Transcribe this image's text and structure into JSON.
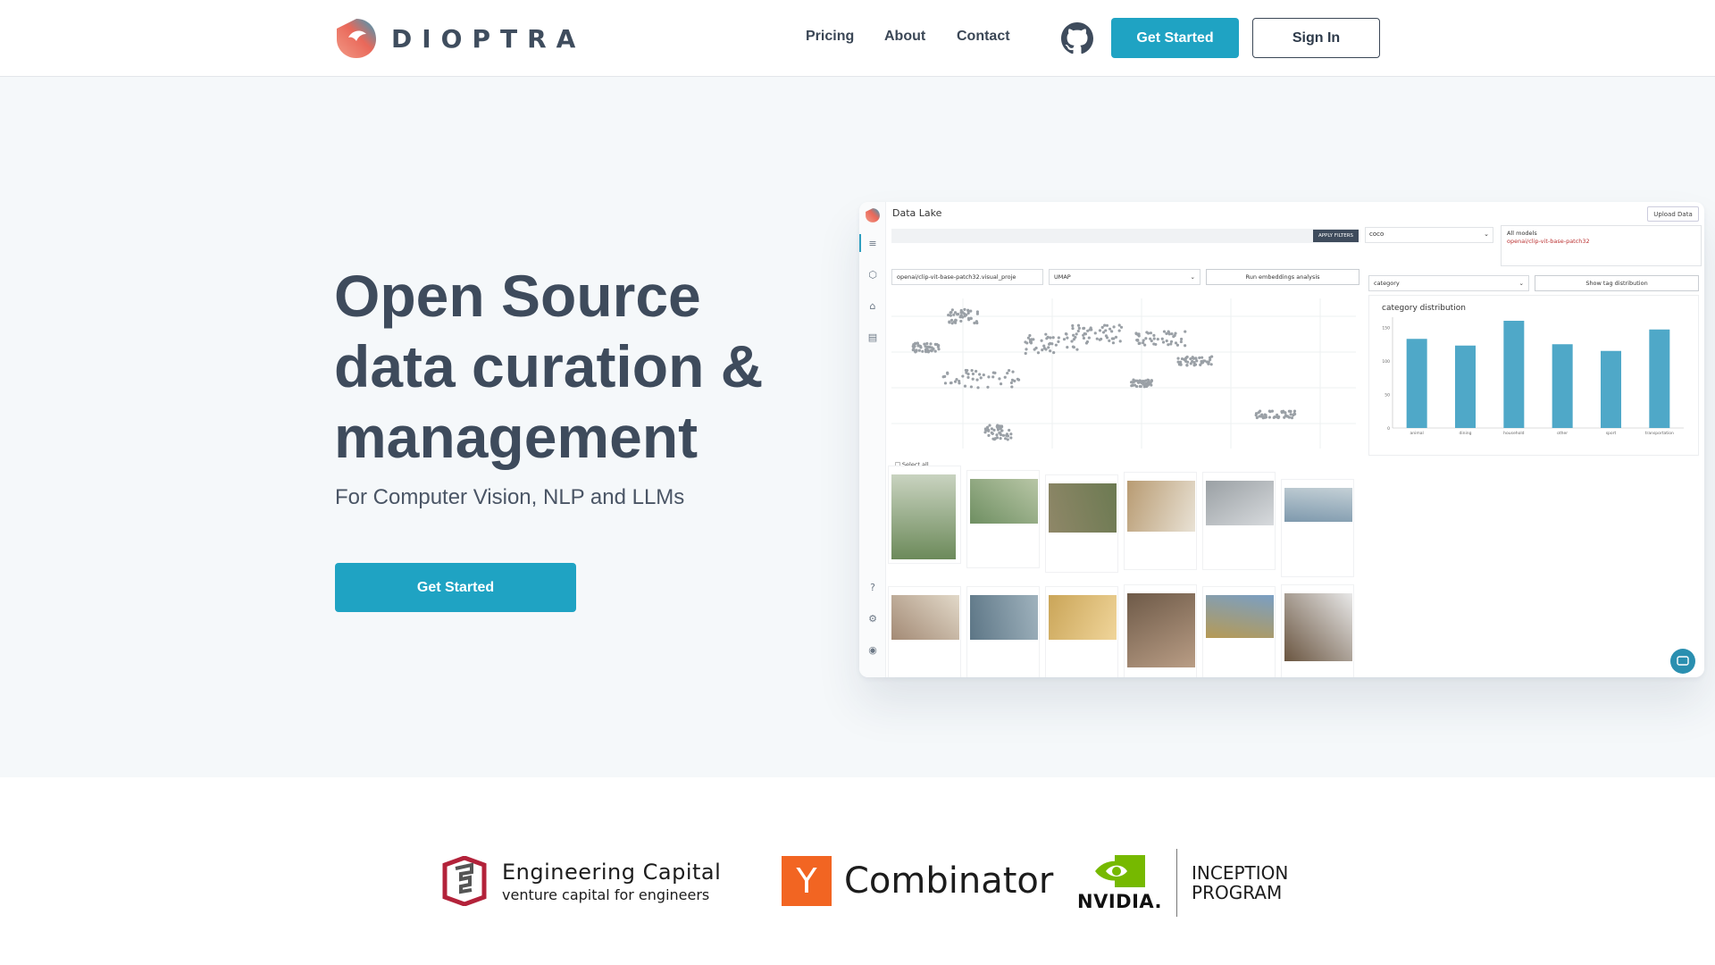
{
  "brand": {
    "name": "DIOPTRA"
  },
  "nav": {
    "links": [
      "Pricing",
      "About",
      "Contact"
    ],
    "github_icon": "github-icon",
    "get_started": "Get Started",
    "sign_in": "Sign In"
  },
  "hero": {
    "title_line1": "Open Source",
    "title_line2": "data curation &",
    "title_line3": "management",
    "subtitle": "For Computer Vision, NLP and LLMs",
    "cta": "Get Started"
  },
  "preview": {
    "title": "Data Lake",
    "upload": "Upload Data",
    "apply_filters": "APPLY FILTERS",
    "dataset": "coco",
    "models_label": "All models",
    "model_name": "openai/clip-vit-base-patch32",
    "embedding_select": "openai/clip-vit-base-patch32.visual_proje",
    "reduction_select": "UMAP",
    "run_button": "Run embeddings analysis",
    "tag_select": "category",
    "tag_button": "Show tag distribution",
    "select_all": "Select all",
    "chart_data": {
      "type": "bar",
      "title": "category distribution",
      "categories": [
        "animal",
        "dining",
        "household",
        "other",
        "sport",
        "transportation"
      ],
      "values": [
        133,
        123,
        160,
        125,
        115,
        147
      ],
      "ylim": [
        0,
        160
      ],
      "yticks": [
        0,
        50,
        100,
        150
      ],
      "color": "#4fa8c8"
    }
  },
  "backers": {
    "engineering_capital": {
      "name": "Engineering  Capital",
      "tagline": "venture capital for engineers"
    },
    "ycombinator": {
      "letter": "Y",
      "name": "Combinator"
    },
    "nvidia": {
      "word": "NVIDIA.",
      "program_line1": "INCEPTION",
      "program_line2": "PROGRAM"
    }
  }
}
